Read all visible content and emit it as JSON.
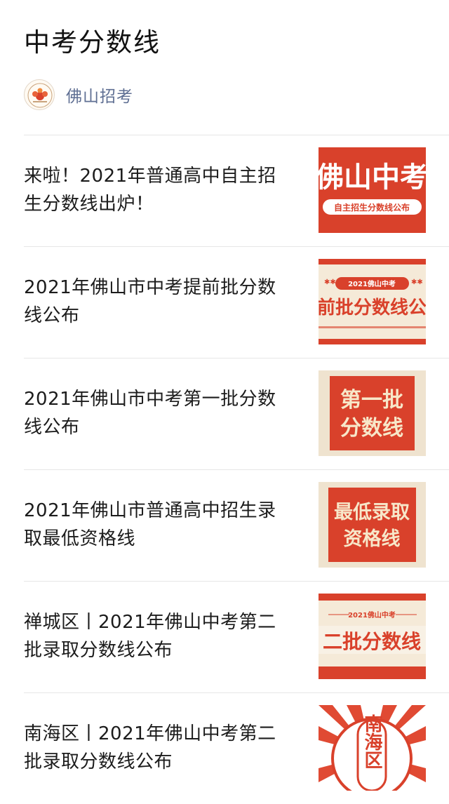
{
  "page_title": "中考分数线",
  "account": {
    "name": "佛山招考",
    "avatar_icon": "foshan-exam-logo-icon",
    "avatar_label": "佛山招考"
  },
  "articles": [
    {
      "title": "来啦！2021年普通高中自主招生分数线出炉！",
      "thumb": {
        "big": "佛山中考",
        "sub": "自主招生分数线公布"
      }
    },
    {
      "title": "2021年佛山市中考提前批分数线公布",
      "thumb": {
        "badge": "2021佛山中考",
        "big": "前批分数线公"
      }
    },
    {
      "title": "2021年佛山市中考第一批分数线公布",
      "thumb": {
        "line1": "第一批",
        "line2": "分数线"
      }
    },
    {
      "title": "2021年佛山市普通高中招生录取最低资格线",
      "thumb": {
        "line1": "最低录取",
        "line2": "资格线"
      }
    },
    {
      "title": "禅城区丨2021年佛山中考第二批录取分数线公布",
      "thumb": {
        "badge": "2021佛山中考",
        "big": "二批分数线"
      }
    },
    {
      "title": "南海区丨2021年佛山中考第二批录取分数线公布",
      "thumb": {
        "big": "南海区"
      }
    }
  ],
  "colors": {
    "accent_red": "#d9412b",
    "cream": "#f5ead8",
    "account_blue": "#5f6f93"
  }
}
